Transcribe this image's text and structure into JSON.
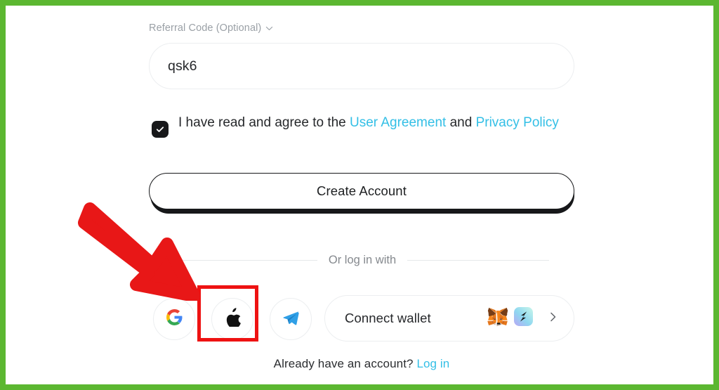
{
  "annotation": {
    "frame_color": "#5cb731",
    "highlight_color": "#ee1212",
    "arrow_color": "#e81717",
    "arrow_target": "apple-login-button"
  },
  "colors": {
    "link": "#33bfe6",
    "text": "#26282b",
    "muted": "#9aa0a6",
    "border": "#eceef0",
    "dark": "#17181a"
  },
  "form": {
    "referral": {
      "label": "Referral Code (Optional)",
      "chevron_icon": "chevron-down-icon",
      "value": "qsk6",
      "placeholder": "Referral Code (Optional)"
    },
    "agreement": {
      "checked": true,
      "checkbox_icon": "check-icon",
      "text_before": "I have read and agree to the ",
      "link_user_agreement": "User Agreement",
      "text_between": " and ",
      "link_privacy_policy": "Privacy Policy"
    },
    "submit": {
      "label": "Create Account"
    }
  },
  "divider": {
    "text": "Or log in with"
  },
  "social": {
    "providers": [
      {
        "name": "google",
        "icon": "google-icon",
        "label": "Google"
      },
      {
        "name": "apple",
        "icon": "apple-icon",
        "label": "Apple"
      },
      {
        "name": "telegram",
        "icon": "telegram-icon",
        "label": "Telegram"
      }
    ],
    "connect_wallet": {
      "label": "Connect wallet",
      "wallet_icons": [
        "metamask-icon",
        "okx-wallet-icon"
      ],
      "chevron_icon": "chevron-right-icon"
    }
  },
  "footer": {
    "text": "Already have an account? ",
    "link": "Log in"
  }
}
